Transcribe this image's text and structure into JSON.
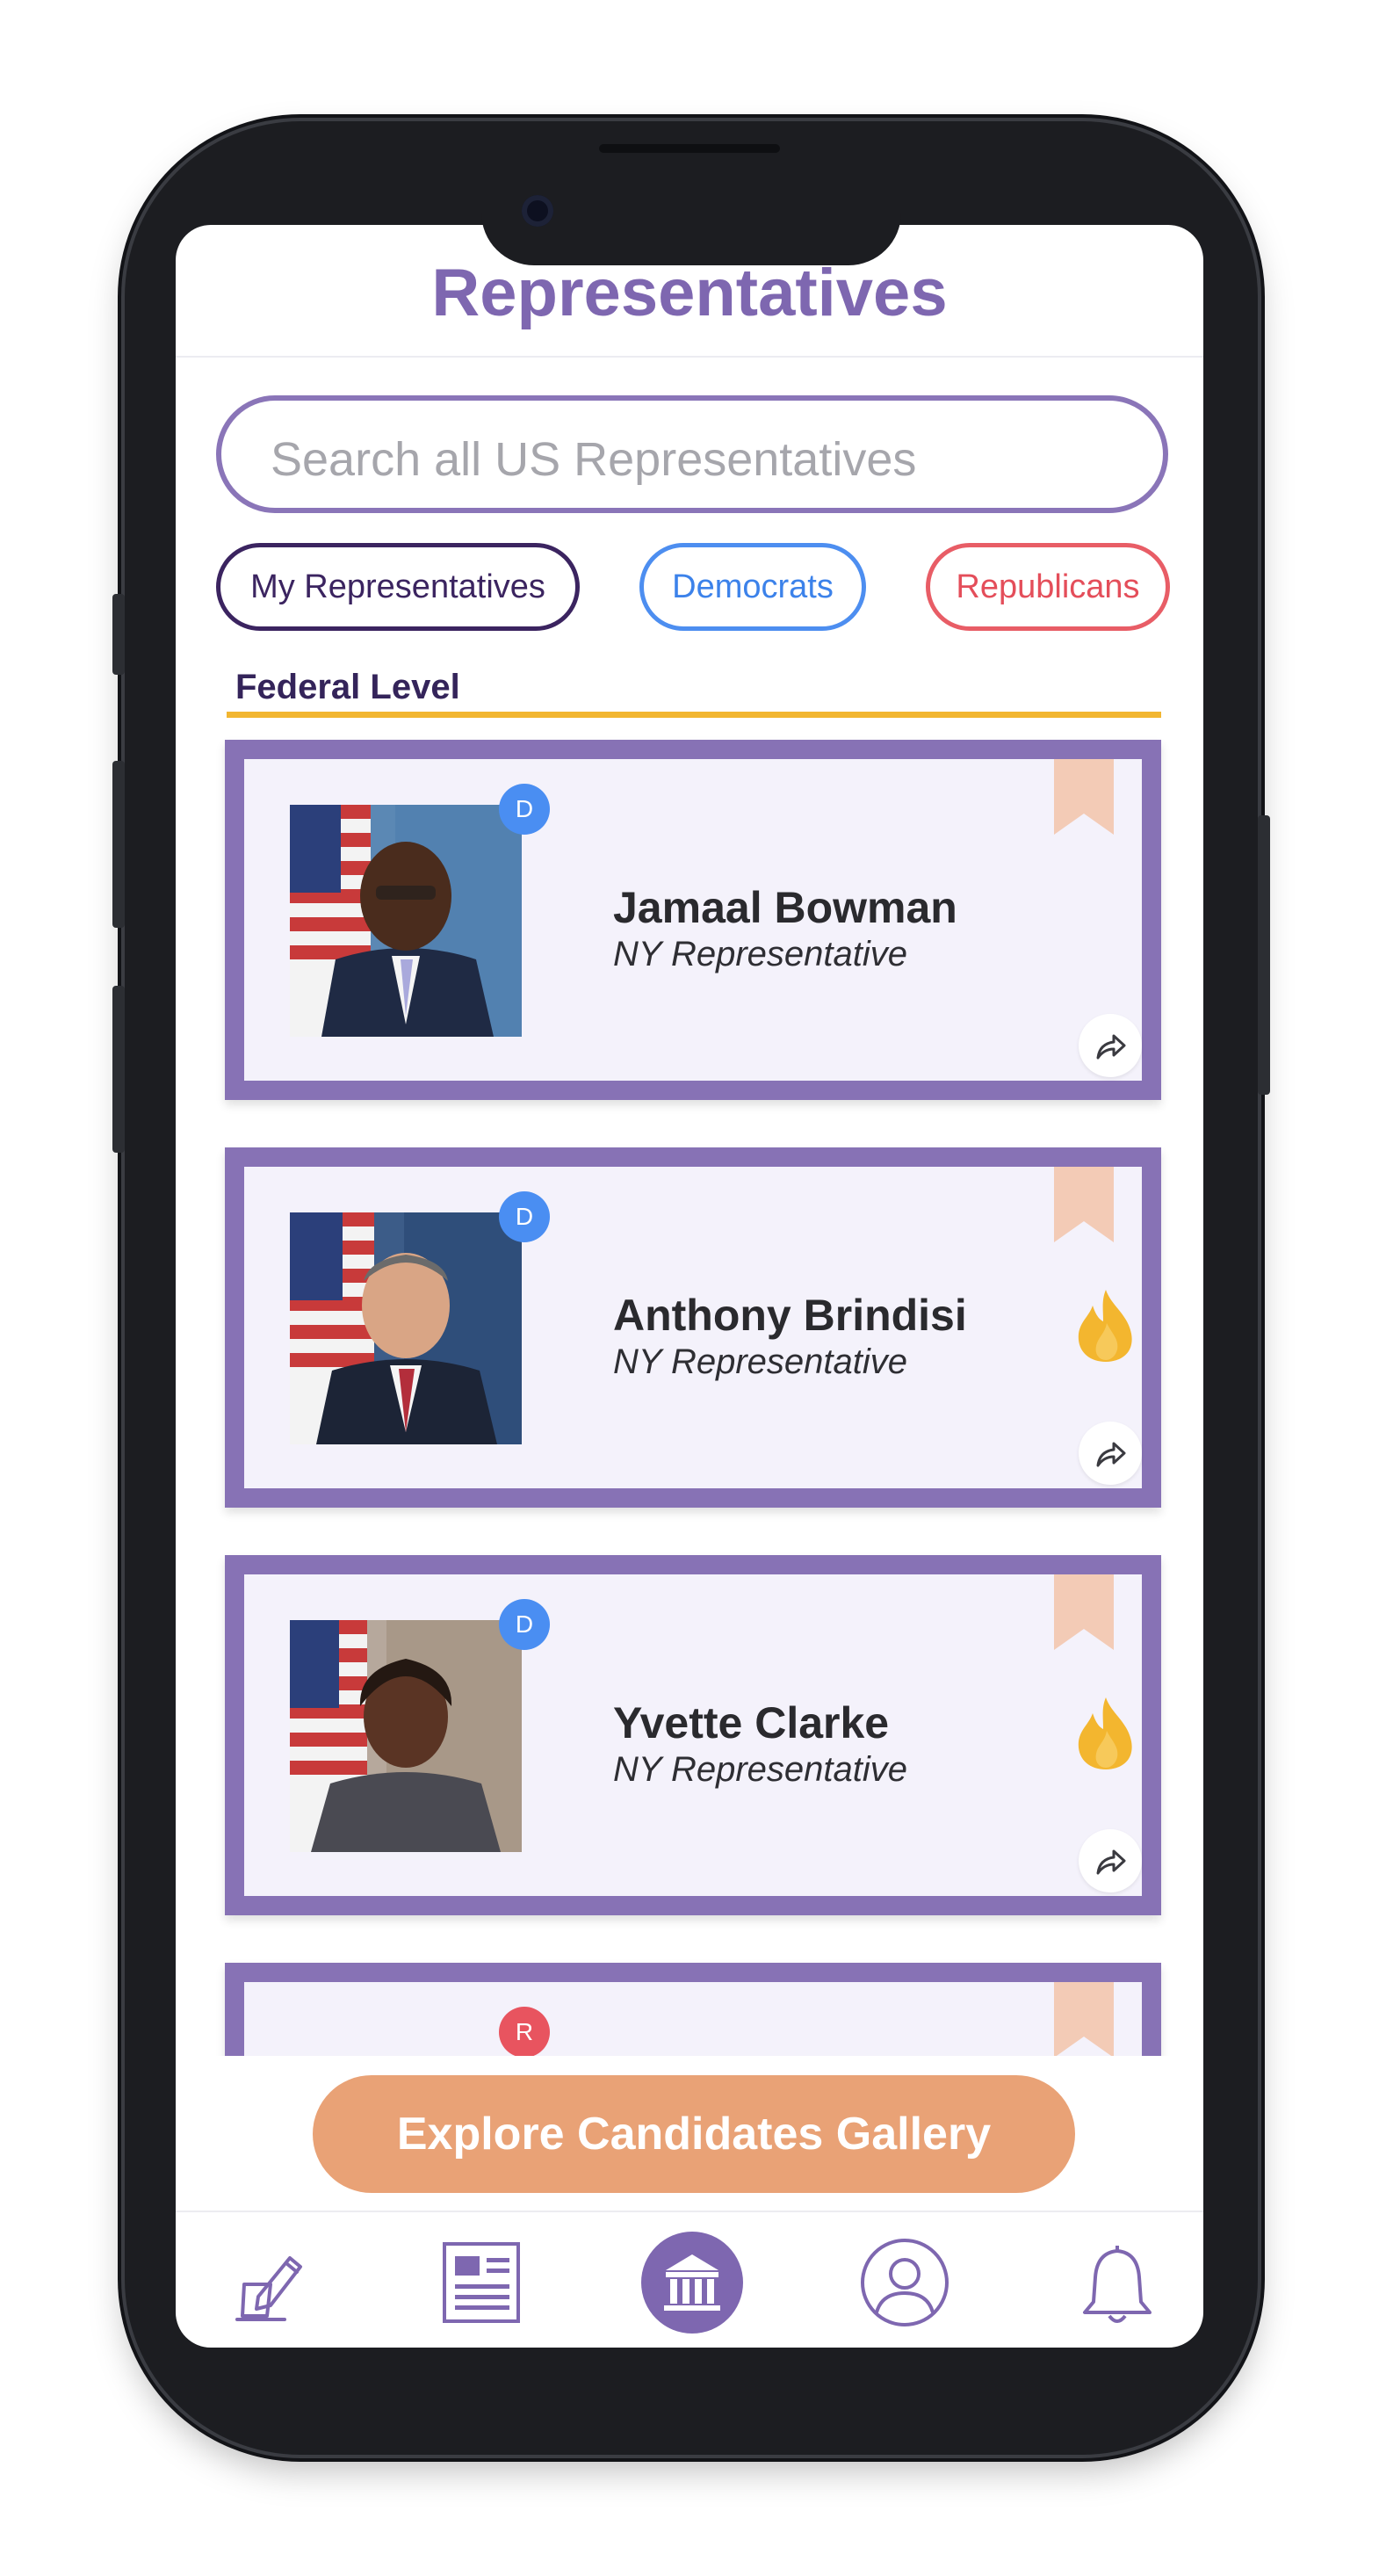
{
  "header": {
    "title": "Representatives"
  },
  "search": {
    "placeholder": "Search all US Representatives"
  },
  "filters": {
    "my_representatives": "My Representatives",
    "democrats": "Democrats",
    "republicans": "Republicans"
  },
  "section": {
    "label": "Federal Level"
  },
  "representatives": [
    {
      "name": "Jamaal Bowman",
      "role": "NY Representative",
      "party_badge": "D",
      "hot": false
    },
    {
      "name": "Anthony Brindisi",
      "role": "NY Representative",
      "party_badge": "D",
      "hot": true
    },
    {
      "name": "Yvette Clarke",
      "role": "NY Representative",
      "party_badge": "D",
      "hot": true
    },
    {
      "name": "",
      "role": "",
      "party_badge": "R",
      "hot": false
    }
  ],
  "cta": {
    "label": "Explore Candidates Gallery"
  },
  "bottom_nav": [
    {
      "icon": "pen-paper-icon"
    },
    {
      "icon": "news-icon"
    },
    {
      "icon": "capitol-building-icon",
      "active": true
    },
    {
      "icon": "profile-icon"
    },
    {
      "icon": "bell-icon"
    }
  ],
  "colors": {
    "accent": "#7e67b0",
    "card_border": "#8772b5",
    "card_bg": "#f4f2fb",
    "democrat": "#4a8ef2",
    "republican": "#e8545f",
    "section_underline": "#f2b630",
    "cta": "#e9a276",
    "bookmark": "#f3cbb6",
    "hot": "#f3b62f"
  }
}
